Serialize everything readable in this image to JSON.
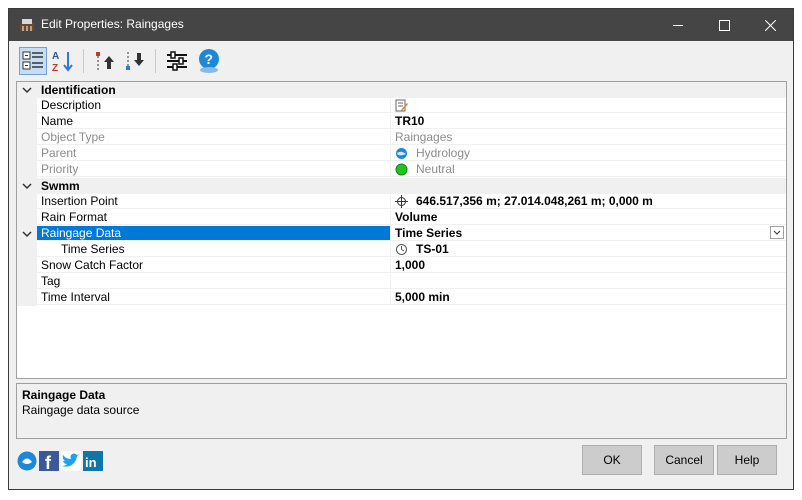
{
  "window": {
    "title": "Edit Properties: Raingages",
    "controls": {
      "minimize_icon": "minimize-icon",
      "maximize_icon": "maximize-icon",
      "close_icon": "close-icon"
    }
  },
  "toolbar": {
    "buttons": [
      {
        "name": "categorized-view",
        "icon": "categorized-list-icon",
        "active": true
      },
      {
        "name": "alphabetical-sort",
        "icon": "az-sort-icon",
        "active": false
      },
      {
        "name": "move-up",
        "icon": "move-up-icon",
        "active": false
      },
      {
        "name": "move-down",
        "icon": "move-down-icon",
        "active": false
      },
      {
        "name": "settings",
        "icon": "sliders-icon",
        "active": false
      },
      {
        "name": "help",
        "icon": "help-icon",
        "active": false
      }
    ]
  },
  "grid": {
    "categories": {
      "identification": "Identification",
      "swmm": "Swmm"
    },
    "rows": {
      "description": {
        "name": "Description",
        "value": ""
      },
      "name": {
        "name": "Name",
        "value": "TR10"
      },
      "object_type": {
        "name": "Object Type",
        "value": "Raingages"
      },
      "parent": {
        "name": "Parent",
        "value": "Hydrology"
      },
      "priority": {
        "name": "Priority",
        "value": "Neutral"
      },
      "insertion_point": {
        "name": "Insertion Point",
        "value": "646.517,356 m; 27.014.048,261 m; 0,000 m"
      },
      "rain_format": {
        "name": "Rain Format",
        "value": "Volume"
      },
      "raingage_data": {
        "name": "Raingage Data",
        "value": "Time Series"
      },
      "time_series": {
        "name": "Time Series",
        "value": "TS-01"
      },
      "snow_catch_factor": {
        "name": "Snow Catch Factor",
        "value": "1,000"
      },
      "tag": {
        "name": "Tag",
        "value": ""
      },
      "time_interval": {
        "name": "Time Interval",
        "value": "5,000 min"
      }
    }
  },
  "help_panel": {
    "title": "Raingage Data",
    "description": "Raingage data source"
  },
  "buttons": {
    "ok": "OK",
    "cancel": "Cancel",
    "help": "Help"
  },
  "colors": {
    "titlebar": "#454545",
    "selection": "#0078d7",
    "priority_neutral": "#1fc41f"
  }
}
